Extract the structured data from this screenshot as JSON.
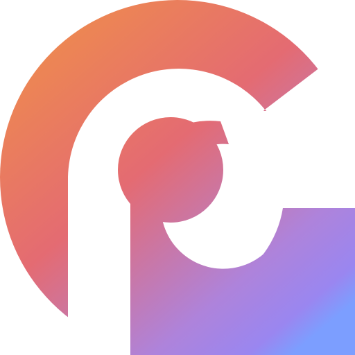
{
  "logo": {
    "icon": "pg-monogram-logo-icon",
    "gradient": {
      "start": "#EE8A4F",
      "middle": "#E46B72",
      "late": "#AE83DB",
      "end": "#9A86F0",
      "highlight": "#7C9EFF"
    },
    "background": "#FFFFFF"
  }
}
